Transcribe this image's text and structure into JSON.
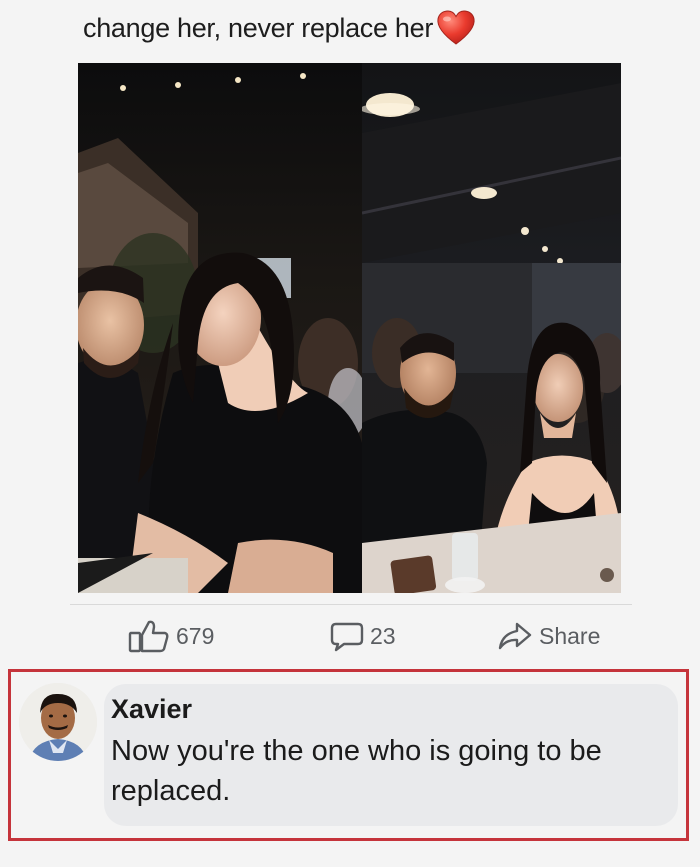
{
  "post": {
    "caption": "change her, never replace her",
    "caption_emoji": "heart-emoji"
  },
  "photos": {
    "left_alt": "couple photo before",
    "right_alt": "couple photo after"
  },
  "actions": {
    "likes_count": "679",
    "comments_count": "23",
    "share_label": "Share",
    "icon_color": "#5a5d61"
  },
  "comment": {
    "author": "Xavier",
    "text": "Now you're the one who is going to be replaced.",
    "highlight_color": "#c5343b"
  }
}
